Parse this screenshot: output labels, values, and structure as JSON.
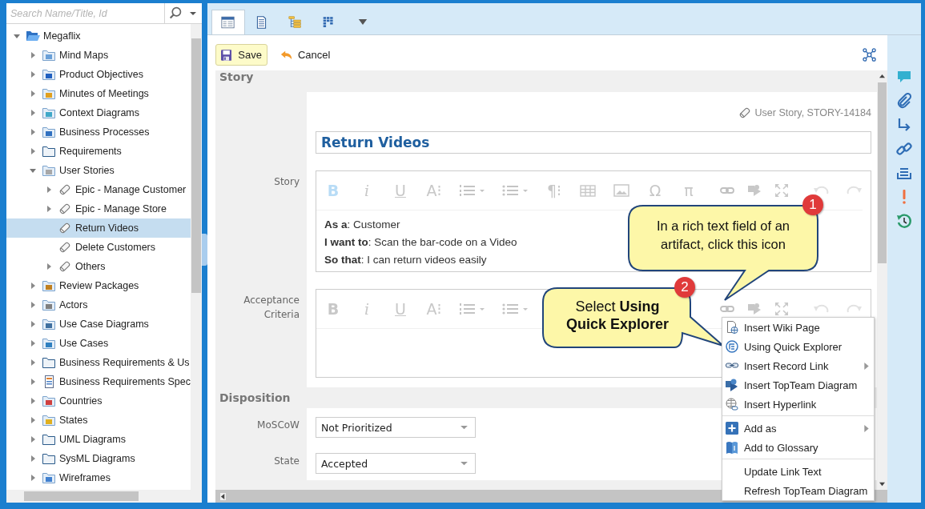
{
  "search": {
    "placeholder": "Search Name/Title, Id"
  },
  "tree": [
    {
      "label": "Megaflix",
      "kind": "project",
      "expandable": true,
      "expanded": true,
      "selected": false,
      "children": [
        {
          "label": "Mind Maps",
          "kind": "typed-folder",
          "color": "#6aa0d8",
          "expandable": true,
          "expanded": false,
          "selected": false
        },
        {
          "label": "Product Objectives",
          "kind": "typed-folder",
          "color": "#2060c0",
          "expandable": true,
          "expanded": false,
          "selected": false
        },
        {
          "label": "Minutes of Meetings",
          "kind": "typed-folder",
          "color": "#e0a020",
          "expandable": true,
          "expanded": false,
          "selected": false
        },
        {
          "label": "Context Diagrams",
          "kind": "typed-folder",
          "color": "#40a8c8",
          "expandable": true,
          "expanded": false,
          "selected": false
        },
        {
          "label": "Business Processes",
          "kind": "typed-folder",
          "color": "#3070c0",
          "expandable": true,
          "expanded": false,
          "selected": false
        },
        {
          "label": "Requirements",
          "kind": "folder",
          "expandable": true,
          "expanded": false,
          "selected": false
        },
        {
          "label": "User Stories",
          "kind": "typed-folder",
          "color": "#a8a8a8",
          "expandable": true,
          "expanded": true,
          "selected": false,
          "children": [
            {
              "label": "Epic - Manage Customer",
              "kind": "story",
              "expandable": true,
              "expanded": false,
              "selected": false
            },
            {
              "label": "Epic - Manage Store",
              "kind": "story",
              "expandable": true,
              "expanded": false,
              "selected": false
            },
            {
              "label": "Return Videos",
              "kind": "story",
              "expandable": false,
              "selected": true
            },
            {
              "label": "Delete Customers",
              "kind": "story",
              "expandable": false,
              "selected": false
            },
            {
              "label": "Others",
              "kind": "story",
              "expandable": true,
              "expanded": false,
              "selected": false
            }
          ]
        },
        {
          "label": "Review Packages",
          "kind": "typed-folder",
          "color": "#c08020",
          "expandable": true,
          "expanded": false,
          "selected": false
        },
        {
          "label": "Actors",
          "kind": "typed-folder",
          "color": "#808080",
          "expandable": true,
          "expanded": false,
          "selected": false
        },
        {
          "label": "Use Case Diagrams",
          "kind": "typed-folder",
          "color": "#4070a0",
          "expandable": true,
          "expanded": false,
          "selected": false
        },
        {
          "label": "Use Cases",
          "kind": "typed-folder",
          "color": "#3080c0",
          "expandable": true,
          "expanded": false,
          "selected": false
        },
        {
          "label": "Business Requirements & Us",
          "kind": "folder",
          "expandable": true,
          "expanded": false,
          "selected": false
        },
        {
          "label": "Business Requirements Spec",
          "kind": "document",
          "expandable": true,
          "expanded": false,
          "selected": false
        },
        {
          "label": "Countries",
          "kind": "typed-folder",
          "color": "#d04040",
          "expandable": true,
          "expanded": false,
          "selected": false
        },
        {
          "label": "States",
          "kind": "typed-folder",
          "color": "#e0b020",
          "expandable": true,
          "expanded": false,
          "selected": false
        },
        {
          "label": "UML Diagrams",
          "kind": "folder",
          "expandable": true,
          "expanded": false,
          "selected": false
        },
        {
          "label": "SysML Diagrams",
          "kind": "folder",
          "expandable": true,
          "expanded": false,
          "selected": false
        },
        {
          "label": "Wireframes",
          "kind": "typed-folder",
          "color": "#4080d0",
          "expandable": true,
          "expanded": false,
          "selected": false
        }
      ]
    }
  ],
  "view_tabs": [
    {
      "selected": true
    },
    {
      "selected": false
    },
    {
      "selected": false
    },
    {
      "selected": false
    }
  ],
  "actions": {
    "save": "Save",
    "cancel": "Cancel"
  },
  "story_section": {
    "title": "Story",
    "artifact_type": "User Story, STORY-14184",
    "name": "Return Videos",
    "fields": [
      {
        "label": "Story",
        "bold_active": true,
        "tools_left": [
          {
            "kind": "bold",
            "text": "B"
          },
          {
            "kind": "italic",
            "text": "i"
          },
          {
            "kind": "underline",
            "text": "U"
          },
          {
            "kind": "char",
            "text": "A⁝"
          },
          {
            "kind": "numbered-list"
          },
          {
            "kind": "bullet-list"
          },
          {
            "kind": "char",
            "text": "¶⁝"
          },
          {
            "kind": "table"
          },
          {
            "kind": "image"
          },
          {
            "kind": "char",
            "text": "Ω"
          },
          {
            "kind": "char",
            "text": "π"
          }
        ],
        "tools_right": [
          {
            "kind": "link"
          },
          {
            "kind": "diagram"
          },
          {
            "kind": "fullscreen"
          },
          {
            "kind": "undo"
          },
          {
            "kind": "redo"
          }
        ],
        "lines": [
          "**As a**: Customer",
          "**I want to**: Scan the bar-code on a Video",
          "**So that**: I can return videos easily"
        ]
      },
      {
        "label": "Acceptance Criteria",
        "bold_active": false,
        "tools_left": [
          {
            "kind": "bold",
            "text": "B"
          },
          {
            "kind": "italic",
            "text": "i"
          },
          {
            "kind": "underline",
            "text": "U"
          },
          {
            "kind": "char",
            "text": "A⁝"
          },
          {
            "kind": "numbered-list"
          },
          {
            "kind": "bullet-list"
          }
        ],
        "tools_right": [
          {
            "kind": "link"
          },
          {
            "kind": "diagram"
          },
          {
            "kind": "fullscreen"
          },
          {
            "kind": "undo"
          },
          {
            "kind": "redo"
          }
        ]
      }
    ]
  },
  "disposition_section": {
    "title": "Disposition",
    "fields": [
      {
        "label": "MoSCoW",
        "value": "Not Prioritized"
      },
      {
        "label": "State",
        "value": "Accepted"
      }
    ]
  },
  "context_menu": [
    {
      "kind": "wiki",
      "label": "Insert Wiki Page",
      "submenu": false
    },
    {
      "kind": "explorer",
      "label": "Using Quick Explorer",
      "submenu": false
    },
    {
      "kind": "record-link",
      "label": "Insert Record Link",
      "submenu": true
    },
    {
      "kind": "diagram",
      "label": "Insert TopTeam Diagram",
      "submenu": false
    },
    {
      "kind": "hyperlink",
      "label": "Insert Hyperlink",
      "submenu": false
    },
    {
      "kind": "separator"
    },
    {
      "kind": "add",
      "label": "Add as",
      "submenu": true
    },
    {
      "kind": "glossary",
      "label": "Add to Glossary",
      "submenu": false
    },
    {
      "kind": "separator"
    },
    {
      "kind": "plain",
      "label": "Update Link Text",
      "submenu": false
    },
    {
      "kind": "plain",
      "label": "Refresh TopTeam Diagram",
      "submenu": false
    }
  ],
  "callouts": [
    {
      "number": "1",
      "text": "In a rich text field of an artifact, click this icon"
    },
    {
      "number": "2",
      "text": "Select **Using Quick Explorer**"
    }
  ]
}
